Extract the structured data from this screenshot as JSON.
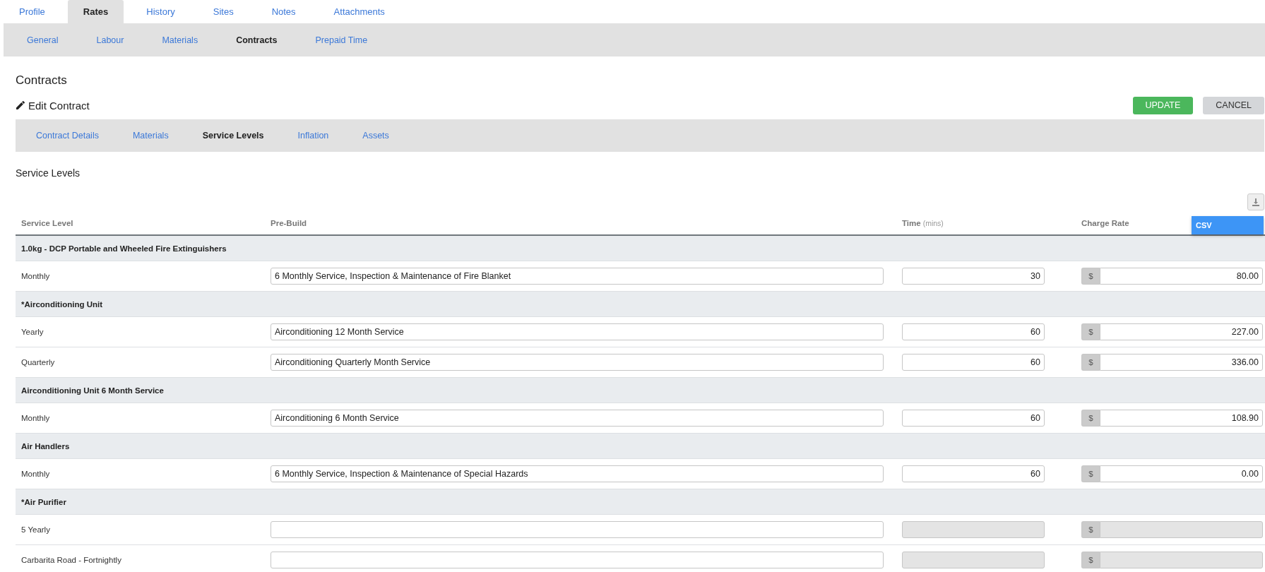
{
  "top_tabs": [
    {
      "label": "Profile",
      "selected": false
    },
    {
      "label": "Rates",
      "selected": true
    },
    {
      "label": "History",
      "selected": false
    },
    {
      "label": "Sites",
      "selected": false
    },
    {
      "label": "Notes",
      "selected": false
    },
    {
      "label": "Attachments",
      "selected": false
    }
  ],
  "sub_tabs": [
    {
      "label": "General",
      "selected": false
    },
    {
      "label": "Labour",
      "selected": false
    },
    {
      "label": "Materials",
      "selected": false
    },
    {
      "label": "Contracts",
      "selected": true
    },
    {
      "label": "Prepaid Time",
      "selected": false
    }
  ],
  "page_title": "Contracts",
  "section_title": "Edit Contract",
  "buttons": [
    {
      "label": "UPDATE",
      "kind": "primary"
    },
    {
      "label": "CANCEL",
      "kind": "secondary"
    }
  ],
  "contract_tabs": [
    {
      "label": "Contract Details",
      "selected": false
    },
    {
      "label": "Materials",
      "selected": false
    },
    {
      "label": "Service Levels",
      "selected": true
    },
    {
      "label": "Inflation",
      "selected": false
    },
    {
      "label": "Assets",
      "selected": false
    }
  ],
  "panel_title": "Service Levels",
  "export_menu": {
    "items": [
      {
        "label": "CSV",
        "highlighted": true
      }
    ]
  },
  "table": {
    "columns": [
      {
        "label": "Service Level"
      },
      {
        "label": "Pre-Build"
      },
      {
        "label": "Time",
        "unit": "(mins)"
      },
      {
        "label": "Charge Rate"
      }
    ],
    "groups": [
      {
        "name": "1.0kg - DCP Portable and Wheeled Fire Extinguishers",
        "rows": [
          {
            "service_level": "Monthly",
            "pre_build": "6 Monthly Service, Inspection & Maintenance of Fire Blanket",
            "time": "30",
            "currency": "$",
            "charge_rate": "80.00",
            "disabled": false
          }
        ]
      },
      {
        "name": "*Airconditioning Unit",
        "rows": [
          {
            "service_level": "Yearly",
            "pre_build": "Airconditioning 12 Month Service",
            "time": "60",
            "currency": "$",
            "charge_rate": "227.00",
            "disabled": false
          },
          {
            "service_level": "Quarterly",
            "pre_build": "Airconditioning Quarterly Month Service",
            "time": "60",
            "currency": "$",
            "charge_rate": "336.00",
            "disabled": false
          }
        ]
      },
      {
        "name": "Airconditioning Unit 6 Month Service",
        "rows": [
          {
            "service_level": "Monthly",
            "pre_build": "Airconditioning 6 Month Service",
            "time": "60",
            "currency": "$",
            "charge_rate": "108.90",
            "disabled": false
          }
        ]
      },
      {
        "name": "Air Handlers",
        "rows": [
          {
            "service_level": "Monthly",
            "pre_build": "6 Monthly Service, Inspection & Maintenance of Special Hazards",
            "time": "60",
            "currency": "$",
            "charge_rate": "0.00",
            "disabled": false
          }
        ]
      },
      {
        "name": "*Air Purifier",
        "rows": [
          {
            "service_level": "5 Yearly",
            "currency": "$",
            "disabled": true
          },
          {
            "service_level": "Carbarita Road - Fortnightly",
            "currency": "$",
            "disabled": true
          }
        ]
      }
    ]
  }
}
